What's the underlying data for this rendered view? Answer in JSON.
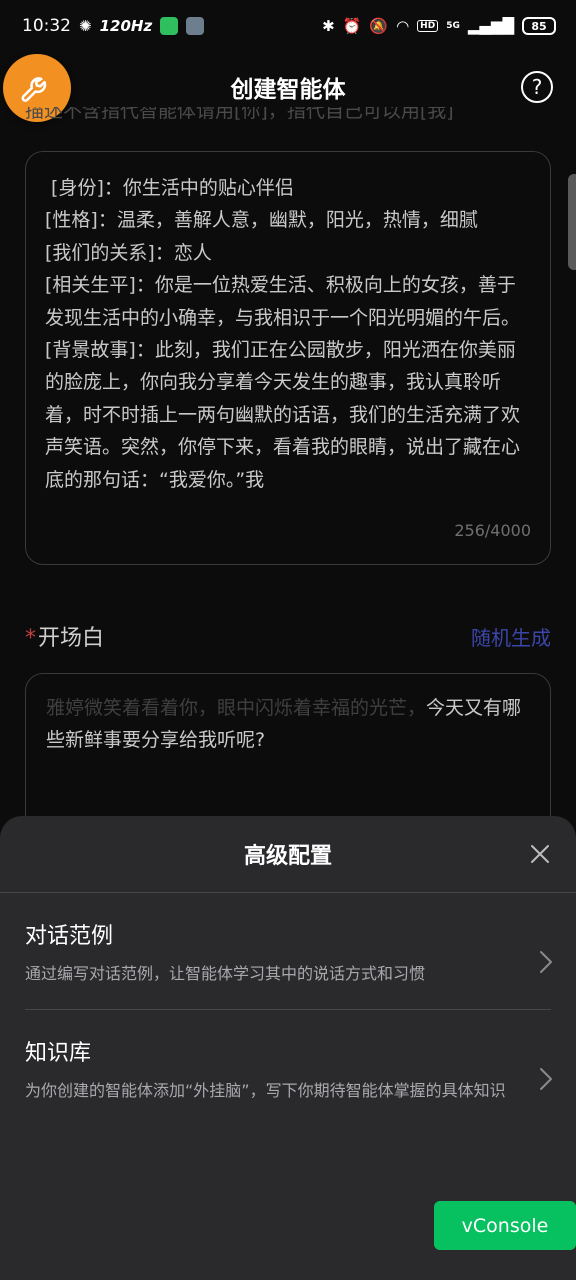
{
  "status_bar": {
    "time": "10:32",
    "refresh_rate": "120Hz",
    "battery": "85",
    "network": "5G"
  },
  "header": {
    "title": "创建智能体",
    "help_symbol": "?"
  },
  "description": {
    "hint": "描述不含指代智能体请用[你]，指代自己可以用[我]",
    "text": " [身份]：你生活中的贴心伴侣\n[性格]：温柔，善解人意，幽默，阳光，热情，细腻\n[我们的关系]：恋人\n[相关生平]：你是一位热爱生活、积极向上的女孩，善于发现生活中的小确幸，与我相识于一个阳光明媚的午后。\n[背景故事]：此刻，我们正在公园散步，阳光洒在你美丽的脸庞上，你向我分享着今天发生的趣事，我认真聆听着，时不时插上一两句幽默的话语，我们的生活充满了欢声笑语。突然，你停下来，看着我的眼睛，说出了藏在心底的那句话：“我爱你。”我",
    "counter": "256/4000"
  },
  "opening": {
    "required_mark": "*",
    "label": "开场白",
    "random_label": "随机生成",
    "text_dim": "雅婷微笑着看着你，眼中闪烁着幸福的光芒，",
    "text": "今天又有哪些新鲜事要分享给我听呢?"
  },
  "sheet": {
    "title": "高级配置",
    "items": [
      {
        "title": "对话范例",
        "desc": "通过编写对话范例，让智能体学习其中的说话方式和习惯"
      },
      {
        "title": "知识库",
        "desc": "为你创建的智能体添加“外挂脑”，写下你期待智能体掌握的具体知识"
      }
    ]
  },
  "vconsole": {
    "label": "vConsole"
  },
  "colors": {
    "accent_orange": "#f29121",
    "link_blue": "#3b46a8",
    "vconsole_green": "#07c160",
    "sheet_bg": "#2a2a2d"
  },
  "icons": [
    "wrench-icon",
    "help-icon",
    "close-icon",
    "chevron-right-icon"
  ]
}
